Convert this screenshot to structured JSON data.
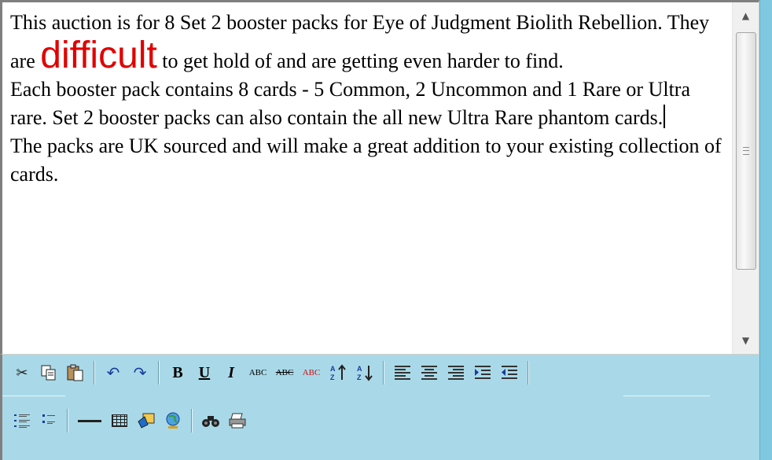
{
  "content": {
    "para1_before": "This auction is for 8 Set 2 booster packs for Eye of Judgment Biolith Rebellion. They are ",
    "para1_highlight": "difficult",
    "para1_after": " to get hold of and are getting even harder to find.",
    "para2": "Each booster pack contains 8 cards - 5 Common, 2 Uncommon and 1 Rare or Ultra rare. Set 2 booster packs can also contain the all new Ultra Rare phantom cards.",
    "para3": "The packs are UK sourced and will make a great addition to your existing collection of cards."
  },
  "colors": {
    "highlight": "#e00000",
    "toolbar_bg": "#a9d9e8"
  },
  "toolbar": {
    "bold": "B",
    "underline": "U",
    "italic": "I",
    "abc": "ABC",
    "abc_strike": "ABC",
    "abc_red": "ABC"
  },
  "icons": [
    "cut-icon",
    "copy-icon",
    "paste-icon",
    "undo-icon",
    "redo-icon",
    "bold-icon",
    "underline-icon",
    "italic-icon",
    "uppercase-icon",
    "strikethrough-icon",
    "font-color-icon",
    "sort-ascending-icon",
    "sort-descending-icon",
    "align-left-icon",
    "align-center-icon",
    "align-right-icon",
    "indent-icon",
    "outdent-icon",
    "numbered-list-icon",
    "bulleted-list-icon",
    "horizontal-rule-icon",
    "table-icon",
    "image-icon",
    "web-link-icon",
    "find-icon",
    "print-icon"
  ]
}
